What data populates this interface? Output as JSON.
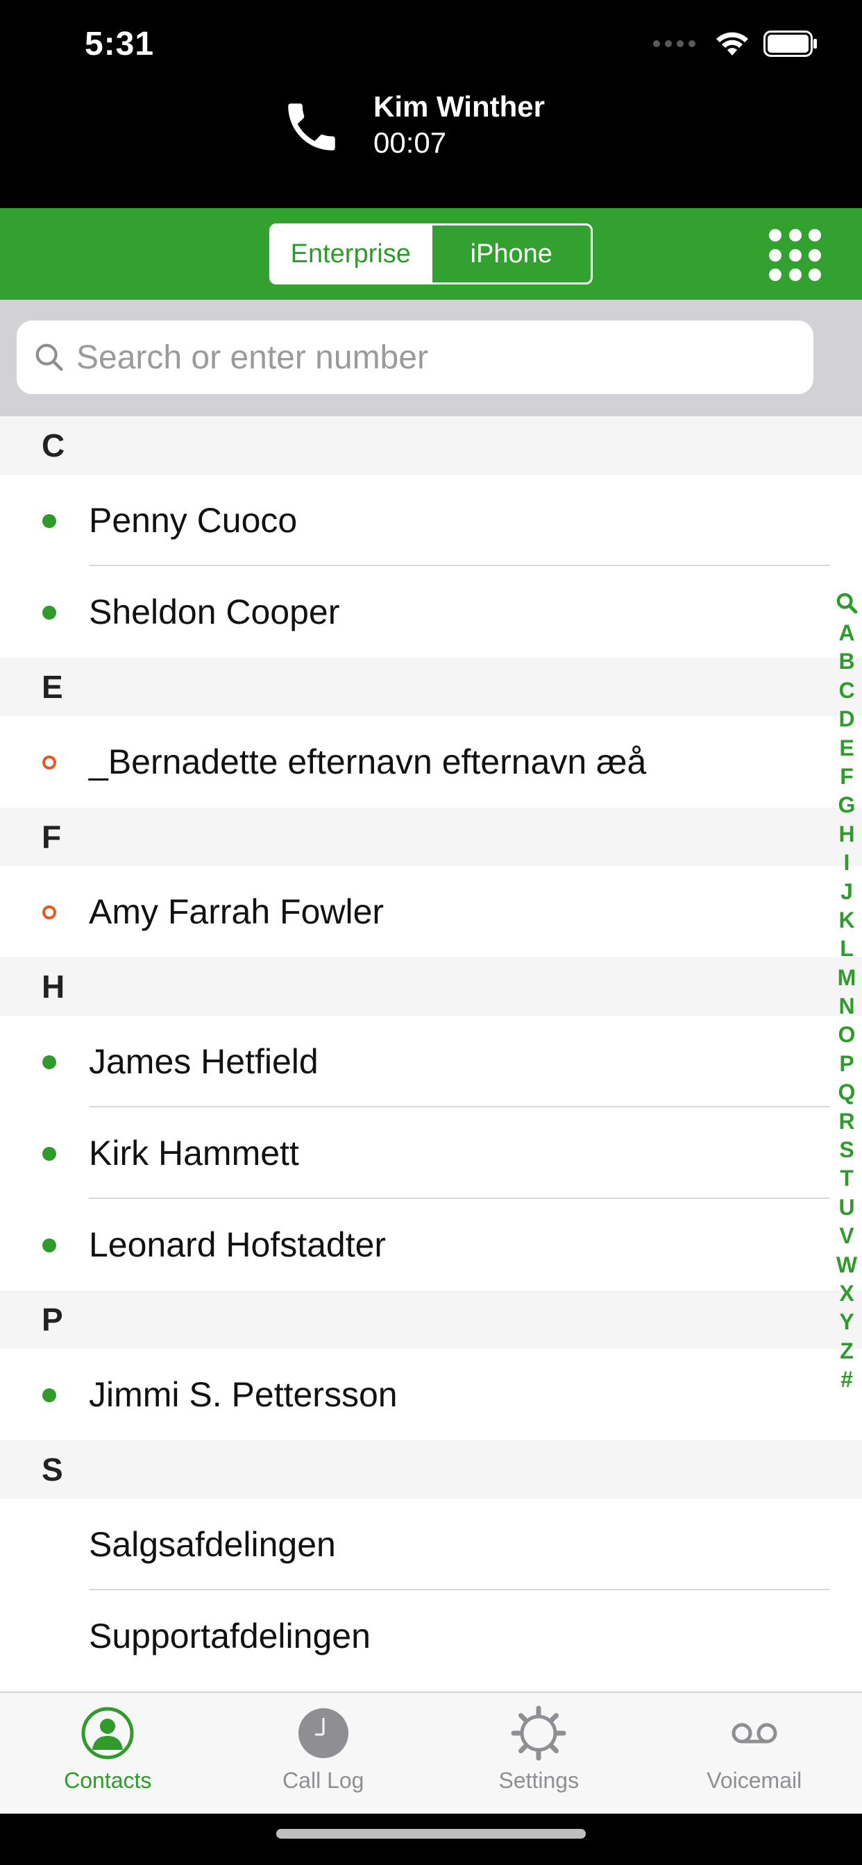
{
  "status_bar": {
    "time": "5:31"
  },
  "call": {
    "name": "Kim Winther",
    "duration": "00:07"
  },
  "segment": {
    "enterprise": "Enterprise",
    "iphone": "iPhone"
  },
  "search": {
    "placeholder": "Search or enter number"
  },
  "sections": [
    {
      "letter": "C",
      "contacts": [
        {
          "name": "Penny Cuoco",
          "presence": "online"
        },
        {
          "name": "Sheldon Cooper",
          "presence": "online"
        }
      ]
    },
    {
      "letter": "E",
      "contacts": [
        {
          "name": "_Bernadette efternavn efternavn æå",
          "presence": "offline"
        }
      ]
    },
    {
      "letter": "F",
      "contacts": [
        {
          "name": "Amy Farrah Fowler",
          "presence": "offline"
        }
      ]
    },
    {
      "letter": "H",
      "contacts": [
        {
          "name": "James Hetfield",
          "presence": "online"
        },
        {
          "name": "Kirk Hammett",
          "presence": "online"
        },
        {
          "name": "Leonard Hofstadter",
          "presence": "online"
        }
      ]
    },
    {
      "letter": "P",
      "contacts": [
        {
          "name": "Jimmi S. Pettersson",
          "presence": "online"
        }
      ]
    },
    {
      "letter": "S",
      "contacts": [
        {
          "name": "Salgsafdelingen",
          "presence": "none"
        },
        {
          "name": "Supportafdelingen",
          "presence": "none"
        }
      ]
    }
  ],
  "index_letters": [
    "A",
    "B",
    "C",
    "D",
    "E",
    "F",
    "G",
    "H",
    "I",
    "J",
    "K",
    "L",
    "M",
    "N",
    "O",
    "P",
    "Q",
    "R",
    "S",
    "T",
    "U",
    "V",
    "W",
    "X",
    "Y",
    "Z",
    "#"
  ],
  "tabs": [
    {
      "label": "Contacts",
      "icon": "contacts-icon",
      "active": true
    },
    {
      "label": "Call Log",
      "icon": "clock-icon",
      "active": false
    },
    {
      "label": "Settings",
      "icon": "gear-icon",
      "active": false
    },
    {
      "label": "Voicemail",
      "icon": "voicemail-icon",
      "active": false
    }
  ],
  "colors": {
    "accent": "#32a12f",
    "online": "#2e9b2b",
    "offline": "#e8571f"
  }
}
